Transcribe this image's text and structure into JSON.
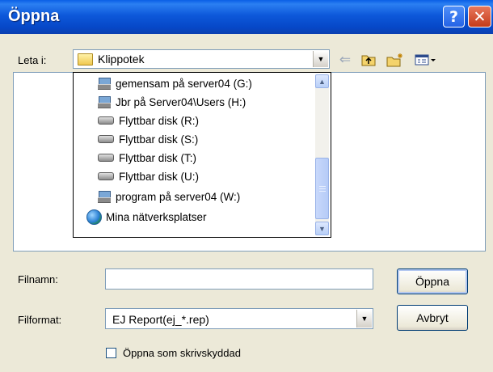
{
  "window": {
    "title": "Öppna",
    "help_glyph": "?",
    "close_glyph": "✕"
  },
  "look_in": {
    "label": "Leta i:",
    "value": "Klippotek"
  },
  "toolbar": {
    "back_icon": "back-arrow-icon",
    "up_icon": "up-one-level-icon",
    "new_folder_icon": "new-folder-icon",
    "view_menu_icon": "view-menu-icon"
  },
  "location_dropdown": {
    "items": [
      {
        "label": "gemensam på server04 (G:)",
        "icon": "network-drive-icon"
      },
      {
        "label": "Jbr på Server04\\Users (H:)",
        "icon": "network-drive-icon"
      },
      {
        "label": "Flyttbar disk (R:)",
        "icon": "removable-disk-icon"
      },
      {
        "label": "Flyttbar disk (S:)",
        "icon": "removable-disk-icon"
      },
      {
        "label": "Flyttbar disk (T:)",
        "icon": "removable-disk-icon"
      },
      {
        "label": "Flyttbar disk (U:)",
        "icon": "removable-disk-icon"
      },
      {
        "label": "program på server04 (W:)",
        "icon": "network-drive-icon"
      },
      {
        "label": "Mina nätverksplatser",
        "icon": "network-places-icon"
      }
    ]
  },
  "filename": {
    "label": "Filnamn:",
    "value": ""
  },
  "filetype": {
    "label": "Filformat:",
    "value": "EJ Report(ej_*.rep)"
  },
  "buttons": {
    "open": "Öppna",
    "cancel": "Avbryt"
  },
  "readonly": {
    "label": "Öppna som skrivskyddad",
    "checked": false
  },
  "colors": {
    "titlebar": "#0a58dc",
    "dialog_bg": "#ece9d8",
    "border": "#7f9db9"
  }
}
